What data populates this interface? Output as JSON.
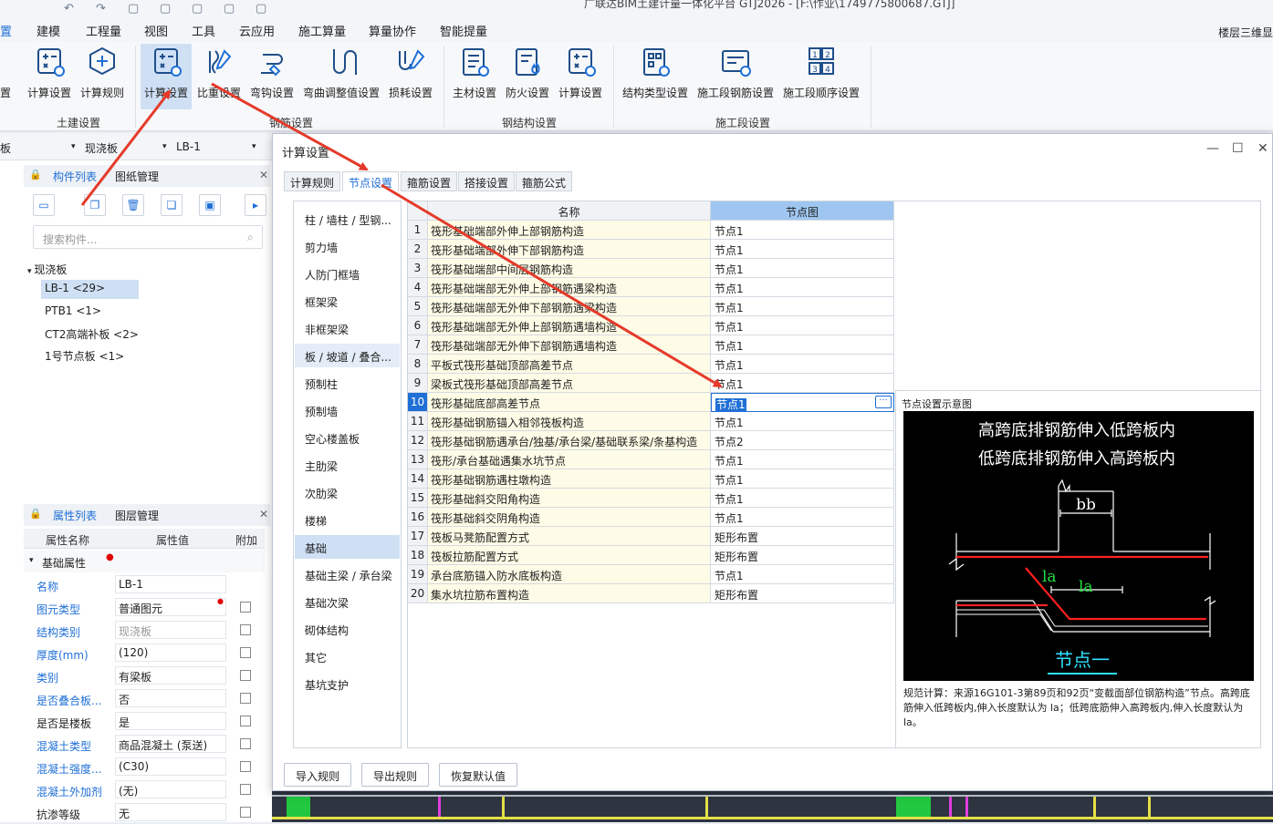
{
  "titlebar": {
    "title": "广联达BIM土建计量一体化平台 GTJ2026 - [F:\\作业\\1749775800687.GTJ]"
  },
  "menu": {
    "items": [
      "置",
      "建模",
      "工程量",
      "视图",
      "工具",
      "云应用",
      "施工算量",
      "算量协作",
      "智能提量"
    ],
    "right": "楼层三维显"
  },
  "ribbon": {
    "buttons": [
      "置",
      "计算设置",
      "计算规则",
      "计算设置",
      "比重设置",
      "弯钩设置",
      "弯曲调整值设置",
      "损耗设置",
      "主材设置",
      "防火设置",
      "计算设置",
      "结构类型设置",
      "施工段钢筋设置",
      "施工段顺序设置"
    ],
    "groups": [
      "土建设置",
      "钢筋设置",
      "钢结构设置",
      "施工段设置"
    ]
  },
  "selectors": {
    "a": "板",
    "b": "现浇板",
    "c": "LB-1"
  },
  "component_panel": {
    "tabs": [
      "构件列表",
      "图纸管理"
    ],
    "search_placeholder": "搜索构件...",
    "tree_root": "现浇板",
    "items": [
      "LB-1 <29>",
      "PTB1 <1>",
      "CT2高端补板 <2>",
      "1号节点板 <1>"
    ]
  },
  "property_panel": {
    "tabs": [
      "属性列表",
      "图层管理"
    ],
    "headers": [
      "属性名称",
      "属性值",
      "附加"
    ],
    "group": "基础属性",
    "rows": [
      {
        "name": "名称",
        "value": "LB-1"
      },
      {
        "name": "图元类型",
        "value": "普通图元"
      },
      {
        "name": "结构类别",
        "value": "现浇板"
      },
      {
        "name": "厚度(mm)",
        "value": "(120)"
      },
      {
        "name": "类别",
        "value": "有梁板"
      },
      {
        "name": "是否叠合板...",
        "value": "否"
      },
      {
        "name": "是否是楼板",
        "value": "是"
      },
      {
        "name": "混凝土类型",
        "value": "商品混凝土 (泵送)"
      },
      {
        "name": "混凝土强度...",
        "value": "(C30)"
      },
      {
        "name": "混凝土外加剂",
        "value": "(无)"
      },
      {
        "name": "抗渗等级",
        "value": "无"
      }
    ]
  },
  "dialog": {
    "title": "计算设置",
    "tabs": [
      "计算规则",
      "节点设置",
      "箍筋设置",
      "搭接设置",
      "箍筋公式"
    ],
    "categories": [
      "柱 / 墙柱 / 型钢...",
      "剪力墙",
      "人防门框墙",
      "框架梁",
      "非框架梁",
      "板 / 坡道 / 叠合...",
      "预制柱",
      "预制墙",
      "空心楼盖板",
      "主肋梁",
      "次肋梁",
      "楼梯",
      "基础",
      "基础主梁 / 承台梁",
      "基础次梁",
      "砌体结构",
      "其它",
      "基坑支护"
    ],
    "grid_headers": [
      "名称",
      "节点图"
    ],
    "rows": [
      {
        "no": "1",
        "name": "筏形基础端部外伸上部钢筋构造",
        "value": "节点1"
      },
      {
        "no": "2",
        "name": "筏形基础端部外伸下部钢筋构造",
        "value": "节点1"
      },
      {
        "no": "3",
        "name": "筏形基础端部中间层钢筋构造",
        "value": "节点1"
      },
      {
        "no": "4",
        "name": "筏形基础端部无外伸上部钢筋遇梁构造",
        "value": "节点1"
      },
      {
        "no": "5",
        "name": "筏形基础端部无外伸下部钢筋遇梁构造",
        "value": "节点1"
      },
      {
        "no": "6",
        "name": "筏形基础端部无外伸上部钢筋遇墙构造",
        "value": "节点1"
      },
      {
        "no": "7",
        "name": "筏形基础端部无外伸下部钢筋遇墙构造",
        "value": "节点1"
      },
      {
        "no": "8",
        "name": "平板式筏形基础顶部高差节点",
        "value": "节点1"
      },
      {
        "no": "9",
        "name": "梁板式筏形基础顶部高差节点",
        "value": "节点1"
      },
      {
        "no": "10",
        "name": "筏形基础底部高差节点",
        "value": "节点1"
      },
      {
        "no": "11",
        "name": "筏形基础钢筋锚入相邻筏板构造",
        "value": "节点1"
      },
      {
        "no": "12",
        "name": "筏形基础钢筋遇承台/独基/承台梁/基础联系梁/条基构造",
        "value": "节点2"
      },
      {
        "no": "13",
        "name": "筏形/承台基础遇集水坑节点",
        "value": "节点1"
      },
      {
        "no": "14",
        "name": "筏形基础钢筋遇柱墩构造",
        "value": "节点1"
      },
      {
        "no": "15",
        "name": "筏形基础斜交阳角构造",
        "value": "节点1"
      },
      {
        "no": "16",
        "name": "筏形基础斜交阴角构造",
        "value": "节点1"
      },
      {
        "no": "17",
        "name": "筏板马凳筋配置方式",
        "value": "矩形布置"
      },
      {
        "no": "18",
        "name": "筏板拉筋配置方式",
        "value": "矩形布置"
      },
      {
        "no": "19",
        "name": "承台底筋锚入防水底板构造",
        "value": "节点1"
      },
      {
        "no": "20",
        "name": "集水坑拉筋布置构造",
        "value": "矩形布置"
      }
    ],
    "preview": {
      "title": "节点设置示意图",
      "line1": "高跨底排钢筋伸入低跨板内",
      "line2": "低跨底排钢筋伸入高跨板内",
      "bb": "bb",
      "la1": "la",
      "la2": "la",
      "caption": "节点一",
      "desc": "规范计算：来源16G101-3第89页和92页“变截面部位钢筋构造”节点。高跨底筋伸入低跨板内,伸入长度默认为 la；低跨底筋伸入高跨板内,伸入长度默认为 la。"
    },
    "buttons": [
      "导入规则",
      "导出规则",
      "恢复默认值"
    ]
  },
  "colors": {
    "accent": "#1f6fd6",
    "arrow": "#e53a2a",
    "rebar": "#ff2020",
    "selected": "#cfe0f5"
  }
}
